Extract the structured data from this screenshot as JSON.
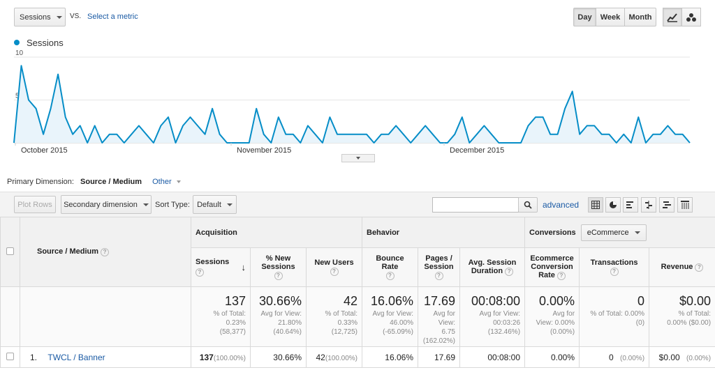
{
  "metric_selector": {
    "value": "Sessions",
    "vs_label": "VS.",
    "select_metric": "Select a metric"
  },
  "period_buttons": [
    "Day",
    "Week",
    "Month"
  ],
  "legend": {
    "series": "Sessions",
    "color": "#058dc7"
  },
  "chart_data": {
    "type": "area",
    "title": "",
    "xlabel": "",
    "ylabel": "",
    "y_ticks": [
      "10",
      "5"
    ],
    "ylim": [
      0,
      10
    ],
    "x_labels": [
      "October 2015",
      "November 2015",
      "December 2015"
    ],
    "series": [
      {
        "name": "Sessions",
        "color": "#058dc7",
        "values": [
          0,
          9,
          5,
          4,
          1,
          4,
          8,
          3,
          1,
          2,
          0,
          2,
          0,
          1,
          1,
          0,
          1,
          2,
          1,
          0,
          2,
          3,
          0,
          2,
          3,
          2,
          1,
          4,
          1,
          0,
          0,
          0,
          0,
          4,
          1,
          0,
          3,
          1,
          1,
          0,
          2,
          1,
          0,
          3,
          1,
          1,
          1,
          1,
          1,
          0,
          1,
          1,
          2,
          1,
          0,
          1,
          2,
          1,
          0,
          0,
          1,
          3,
          0,
          1,
          2,
          1,
          0,
          0,
          0,
          0,
          2,
          3,
          3,
          1,
          1,
          4,
          6,
          1,
          2,
          2,
          1,
          1,
          0,
          1,
          0,
          3,
          0,
          1,
          1,
          2,
          1,
          1,
          0
        ]
      }
    ]
  },
  "primary_dimension": {
    "label": "Primary Dimension:",
    "value": "Source / Medium",
    "other": "Other"
  },
  "toolbar": {
    "plot_rows": "Plot Rows",
    "secondary_dimension": "Secondary dimension",
    "sort_type_label": "Sort Type:",
    "sort_type_value": "Default",
    "search_placeholder": "",
    "advanced": "advanced"
  },
  "table": {
    "dimension_header": "Source / Medium",
    "groups": {
      "acquisition": "Acquisition",
      "behavior": "Behavior",
      "conversions": "Conversions",
      "conversions_select": "eCommerce"
    },
    "columns": {
      "sessions": "Sessions",
      "new_sessions": "% New Sessions",
      "new_users": "New Users",
      "bounce_rate": "Bounce Rate",
      "pages_session": "Pages / Session",
      "avg_duration": "Avg. Session Duration",
      "ecom_rate": "Ecommerce Conversion Rate",
      "transactions": "Transactions",
      "revenue": "Revenue"
    },
    "totals": {
      "sessions": {
        "value": "137",
        "sub1": "% of Total:",
        "sub2": "0.23%",
        "sub3": "(58,377)"
      },
      "new_sessions": {
        "value": "30.66%",
        "sub1": "Avg for View:",
        "sub2": "21.80%",
        "sub3": "(40.64%)"
      },
      "new_users": {
        "value": "42",
        "sub1": "% of Total:",
        "sub2": "0.33%",
        "sub3": "(12,725)"
      },
      "bounce_rate": {
        "value": "16.06%",
        "sub1": "Avg for View:",
        "sub2": "46.00%",
        "sub3": "(-65.09%)"
      },
      "pages_session": {
        "value": "17.69",
        "sub1": "Avg for",
        "sub2": "View:",
        "sub3": "6.75",
        "sub4": "(162.02%)"
      },
      "avg_duration": {
        "value": "00:08:00",
        "sub1": "Avg for View:",
        "sub2": "00:03:26",
        "sub3": "(132.46%)"
      },
      "ecom_rate": {
        "value": "0.00%",
        "sub1": "Avg for",
        "sub2": "View: 0.00%",
        "sub3": "(0.00%)"
      },
      "transactions": {
        "value": "0",
        "sub1": "% of Total: 0.00%",
        "sub2": "(0)"
      },
      "revenue": {
        "value": "$0.00",
        "sub1": "% of Total:",
        "sub2": "0.00% ($0.00)"
      }
    },
    "rows": [
      {
        "index": "1.",
        "source": "TWCL / Banner",
        "sessions": "137",
        "sessions_pct": "(100.00%)",
        "new_sessions": "30.66%",
        "new_users": "42",
        "new_users_pct": "(100.00%)",
        "bounce_rate": "16.06%",
        "pages_session": "17.69",
        "avg_duration": "00:08:00",
        "ecom_rate": "0.00%",
        "transactions": "0",
        "transactions_pct": "(0.00%)",
        "revenue": "$0.00",
        "revenue_pct": "(0.00%)"
      }
    ]
  }
}
